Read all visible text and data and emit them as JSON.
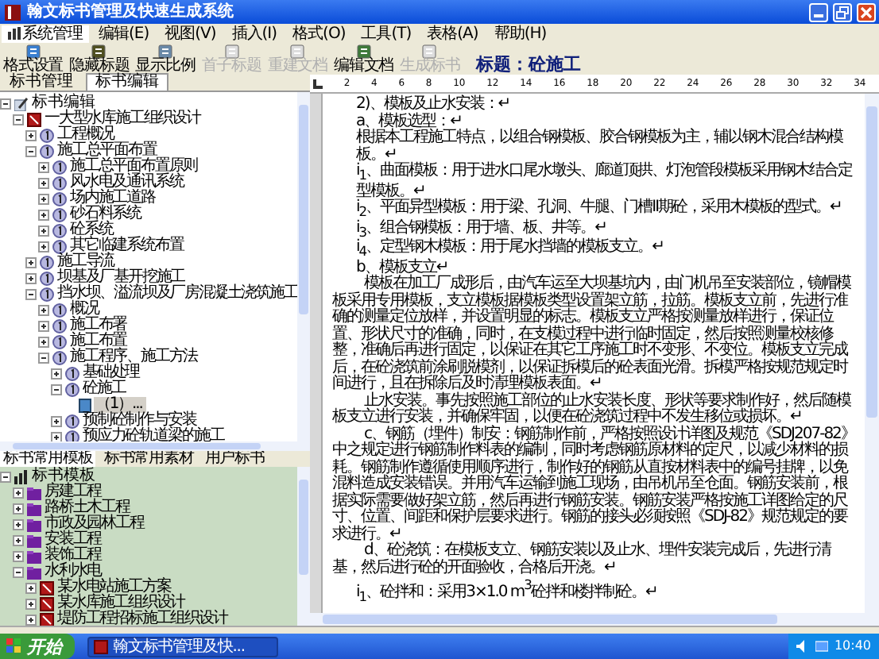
{
  "window": {
    "title": "翰文标书管理及快速生成系统"
  },
  "menu": [
    {
      "label": "系统管理",
      "selected": true
    },
    {
      "label": "编辑(E)",
      "selected": false
    },
    {
      "label": "视图(V)",
      "selected": false
    },
    {
      "label": "插入(I)",
      "selected": false
    },
    {
      "label": "格式(O)",
      "selected": false
    },
    {
      "label": "工具(T)",
      "selected": false
    },
    {
      "label": "表格(A)",
      "selected": false
    },
    {
      "label": "帮助(H)",
      "selected": false
    }
  ],
  "toolbar": [
    {
      "label": "格式设置",
      "disabled": false
    },
    {
      "label": "隐藏标题",
      "disabled": false
    },
    {
      "label": "显示比例",
      "disabled": false
    },
    {
      "label": "首子标题",
      "disabled": true
    },
    {
      "label": "重建文档",
      "disabled": true
    },
    {
      "label": "编辑文档",
      "disabled": false
    },
    {
      "label": "生成标书",
      "disabled": true
    }
  ],
  "heading": "标题：砼施工",
  "panel_tabs": [
    {
      "label": "标书管理",
      "selected": false
    },
    {
      "label": "标书编辑",
      "selected": true
    }
  ],
  "edit_tree": {
    "label": "标书编辑",
    "kind": "root",
    "expanded": true,
    "selected": false,
    "children": [
      {
        "label": "一大型水库施工组织设计",
        "kind": "doc",
        "expanded": true,
        "selected": false,
        "children": [
          {
            "label": "工程概况",
            "kind": "section",
            "expanded": false,
            "selected": false
          },
          {
            "label": "施工总平面布置",
            "kind": "section",
            "expanded": true,
            "selected": false,
            "children": [
              {
                "label": "施工总平面布置原则",
                "kind": "section",
                "expanded": false,
                "selected": false
              },
              {
                "label": "风水电及通讯系统",
                "kind": "section",
                "expanded": false,
                "selected": false
              },
              {
                "label": "场内施工道路",
                "kind": "section",
                "expanded": false,
                "selected": false
              },
              {
                "label": "砂石料系统",
                "kind": "section",
                "expanded": false,
                "selected": false
              },
              {
                "label": "砼系统",
                "kind": "section",
                "expanded": false,
                "selected": false
              },
              {
                "label": "其它临建系统布置",
                "kind": "section",
                "expanded": false,
                "selected": false
              }
            ]
          },
          {
            "label": "施工导流",
            "kind": "section",
            "expanded": false,
            "selected": false
          },
          {
            "label": "坝基及厂基开挖施工",
            "kind": "section",
            "expanded": false,
            "selected": false
          },
          {
            "label": "挡水坝、溢流坝及厂房混凝土浇筑施工",
            "kind": "section",
            "expanded": true,
            "selected": false,
            "children": [
              {
                "label": "概况",
                "kind": "section",
                "expanded": false,
                "selected": false
              },
              {
                "label": "施工布署",
                "kind": "section",
                "expanded": false,
                "selected": false
              },
              {
                "label": "施工布置",
                "kind": "section",
                "expanded": false,
                "selected": false
              },
              {
                "label": "施工程序、施工方法",
                "kind": "section",
                "expanded": true,
                "selected": false,
                "children": [
                  {
                    "label": "基础处理",
                    "kind": "section",
                    "expanded": false,
                    "selected": false
                  },
                  {
                    "label": "砼施工",
                    "kind": "section",
                    "expanded": true,
                    "selected": false,
                    "children": [
                      {
                        "label": "（1）...",
                        "kind": "page",
                        "selected": true
                      }
                    ]
                  },
                  {
                    "label": "预制砼制作与安装",
                    "kind": "section",
                    "expanded": false,
                    "selected": false
                  },
                  {
                    "label": "预应力砼轨道梁的施工",
                    "kind": "section",
                    "expanded": false,
                    "selected": false
                  }
                ]
              }
            ]
          }
        ]
      }
    ]
  },
  "library_tabs": [
    {
      "label": "标书常用模板",
      "selected": true
    },
    {
      "label": "标书常用素材",
      "selected": false
    },
    {
      "label": "用户标书",
      "selected": false
    }
  ],
  "library_tree": {
    "label": "标书模板",
    "kind": "root",
    "expanded": true,
    "children": [
      {
        "label": "房建工程",
        "kind": "category",
        "expanded": false
      },
      {
        "label": "路桥土木工程",
        "kind": "category",
        "expanded": false
      },
      {
        "label": "市政及园林工程",
        "kind": "category",
        "expanded": false
      },
      {
        "label": "安装工程",
        "kind": "category",
        "expanded": false
      },
      {
        "label": "装饰工程",
        "kind": "category",
        "expanded": false
      },
      {
        "label": "水利水电",
        "kind": "category",
        "expanded": true,
        "children": [
          {
            "label": "某水电站施工方案",
            "kind": "doc",
            "expanded": false
          },
          {
            "label": "某水库施工组织设计",
            "kind": "doc",
            "expanded": false
          },
          {
            "label": "堤防工程招标施工组织设计",
            "kind": "doc",
            "expanded": false
          }
        ]
      }
    ]
  },
  "ruler_marks": [
    "2",
    "4",
    "6",
    "8",
    "10",
    "12",
    "14",
    "16",
    "18",
    "20",
    "22",
    "24",
    "26",
    "28",
    "30",
    "32",
    "34"
  ],
  "document": [
    {
      "kind": "plain",
      "text": "2)、模板及止水安装：↵"
    },
    {
      "kind": "plain",
      "text": "a、模板选型：↵"
    },
    {
      "kind": "plain",
      "text": "根据本工程施工特点，以组合钢模板、胶合钢模板为主，辅以钢木混合结构模板。↵"
    },
    {
      "kind": "plain",
      "text": "i$_{1}$、曲面模板：用于进水口尾水墩头、廊道顶拱、灯泡管段模板采用钢木结合定型模板。↵"
    },
    {
      "kind": "plain",
      "text": "i$_{2}$、平面异型模板：用于梁、孔洞、牛腿、门槽Ⅱ期砼，采用木模板的型式。↵"
    },
    {
      "kind": "plain",
      "text": "i$_{3}$、组合钢模板：用于墙、板、井等。↵"
    },
    {
      "kind": "plain",
      "text": "i$_{4}$、定型钢木模板：用于尾水挡墙的模板支立。↵"
    },
    {
      "kind": "plain",
      "text": "b、模板支立↵"
    },
    {
      "kind": "body",
      "text": "模板在加工厂成形后，由汽车运至大坝基坑内，由门机吊至安装部位，镜帽模板采用专用模板，支立模板据模板类型设置架立筋，拉筋。模板支立前，先进行准确的测量定位放样，并设置明显的标志。模板支立严格按测量放样进行，保证位置、形状尺寸的准确，同时，在支模过程中进行临时固定，然后按照测量校核修整，准确后再进行固定，以保证在其它工序施工时不变形、不变位。模板支立完成后，在砼浇筑前涂刷脱模剂，以保证拆模后的砼表面光滑。拆模严格按规范规定时间进行，且在拆除后及时清理模板表面。↵"
    },
    {
      "kind": "body",
      "text": "止水安装。事先按照施工部位的止水安装长度、形状等要求制作好，然后随模板支立进行安装，并确保牢固，以便在砼浇筑过程中不发生移位或损坏。↵"
    },
    {
      "kind": "body",
      "text": "c、钢筋（埋件）制安：钢筋制作前，严格按照设计详图及规范《SDJ207-82》中之规定进行钢筋制作料表的编制，同时考虑钢筋原材料的定尺，以减少材料的损耗。钢筋制作遵循使用顺序进行，制作好的钢筋从直按材料表中的编号挂牌，以免混料造成安装错误。并用汽车运输到施工现场，由吊机吊至仓面。钢筋安装前，根据实际需要做好架立筋，然后再进行钢筋安装。钢筋安装严格按施工详图给定的尺寸、位置、间距和保护层要求进行。钢筋的接头必须按照《SDJ-82》规范规定的要求进行。↵"
    },
    {
      "kind": "body",
      "text": "d、砼浇筑：在模板支立、钢筋安装以及止水、埋件安装完成后，先进行清基，然后进行砼的开面验收，合格后开浇。↵"
    },
    {
      "kind": "plain",
      "text": "i$_{1}$、砼拌和：采用3×1.0 m$^{3}$砼拌和楼拌制砼。↵"
    }
  ],
  "taskbar": {
    "start": "开始",
    "task": "翰文标书管理及快...",
    "clock": "10:40"
  }
}
